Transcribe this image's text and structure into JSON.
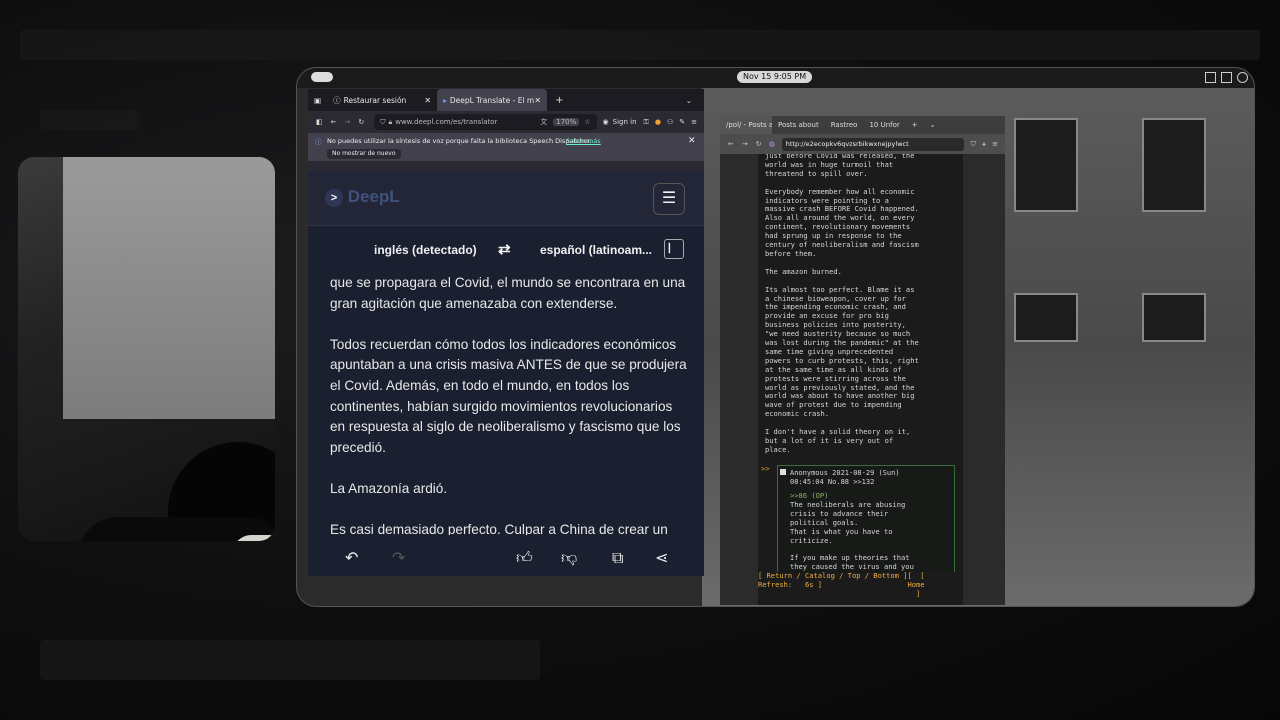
{
  "topbar": {
    "clock": "Nov 15   9:05 PM"
  },
  "browser1": {
    "tabs": [
      {
        "label": "Restaurar sesión"
      },
      {
        "label": "DeepL Translate - El mejor t"
      }
    ],
    "new_tab": "+",
    "url": "www.deepl.com/es/translator",
    "zoom": "170%",
    "sign_in": "Sign in",
    "notification": {
      "message": "No puedes utilizar la síntesis de voz porque falta la biblioteca Speech Dispatcher.",
      "link": "Saber más",
      "dismiss": "No mostrar de nuevo"
    }
  },
  "deepl": {
    "logo": "DeepL",
    "source_lang": "inglés (detectado)",
    "target_lang": "español (latinoam...",
    "paragraphs": [
      "que se propagara el Covid, el mundo se encontrara en una gran agitación que amenazaba con extenderse.",
      "Todos recuerdan cómo todos los indicadores económicos apuntaban a una crisis masiva ANTES de que se produjera el Covid. Además, en todo el mundo, en todos los continentes, habían surgido movimientos revolucionarios en respuesta al siglo de neoliberalismo y fascismo que los precedió.",
      "La Amazonía ardió.",
      "Es casi demasiado perfecto. Culpar a China de crear un"
    ]
  },
  "browser2": {
    "tabs": [
      {
        "label": "/pol/ - Posts about"
      },
      {
        "label": "Posts about"
      },
      {
        "label": "Rastreo"
      },
      {
        "label": "10 Unfor"
      }
    ],
    "url": "http://e2ecopkv6qvzsrbikwxnejpylwct",
    "thread_text": "just before Covid was released, the\nworld was in huge turmoil that\nthreatend to spill over.\n\nEverybody remember how all economic\nindicators were pointing to a\nmassive crash BEFORE Covid happened.\nAlso all around the world, on every\ncontinent, revolutionary movements\nhad sprung up in response to the\ncentury of neoliberalism and fascism\nbefore them.\n\nThe amazon burned.\n\nIts almost too perfect. Blame it as\na chinese bioweapon, cover up for\nthe impending economic crash, and\nprovide an excuse for pro big\nbusiness policies into posterity,\n\"we need austerity because so much\nwas lost during the pandemic\" at the\nsame time giving unprecedented\npowers to curb protests, this, right\nat the same time as all kinds of\nprotests were stirring across the\nworld as previously stated, and the\nworld was about to have another big\nwave of protest due to impending\neconomic crash.\n\nI don't have a solid theory on it,\nbut a lot of it is very out of\nplace.",
    "reply": {
      "header": "Anonymous 2021-08-29 (Sun)\n08:45:04 No.88 >>132",
      "quote": ">>86 (OP)",
      "body": "The neoliberals are abusing\ncrisis to advance their\npolitical goals.\nThat is what you have to\ncriticize.\n\nIf you make up theories that\nthey caused the virus and you"
    },
    "footer": "[ Return / Catalog / Top / Bottom ][  [\nRefresh:   6s ]                    Home\n                                     ]"
  }
}
